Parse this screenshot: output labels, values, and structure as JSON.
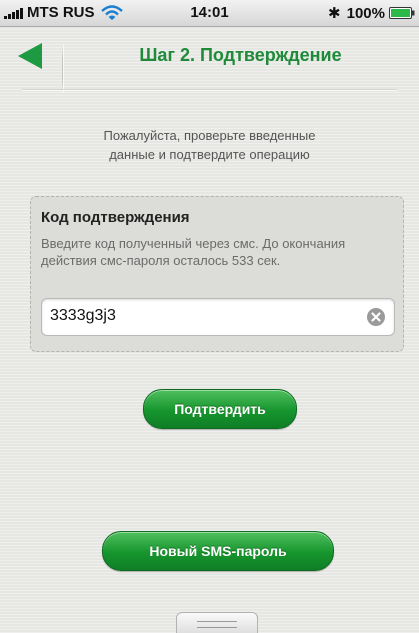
{
  "status_bar": {
    "carrier": "MTS RUS",
    "time": "14:01",
    "battery": "100%",
    "icons": [
      "signal-icon",
      "wifi-icon",
      "bluetooth-icon",
      "battery-icon"
    ]
  },
  "nav": {
    "title": "Шаг 2. Подтверждение",
    "back_icon": "back-arrow-icon"
  },
  "instructions": {
    "line1": "Пожалуйста, проверьте введенные",
    "line2": "данные и подтвердите операцию"
  },
  "code_panel": {
    "title": "Код подтверждения",
    "description": "Введите код полученный через смс. До окончания действия смс-пароля осталось 533 сек.",
    "value": "3333g3j3"
  },
  "buttons": {
    "confirm": "Подтвердить",
    "new_sms": "Новый SMS-пароль"
  },
  "colors": {
    "accent_green": "#1e8a3a",
    "button_green": "#16952d",
    "background": "#e6e6e3"
  }
}
